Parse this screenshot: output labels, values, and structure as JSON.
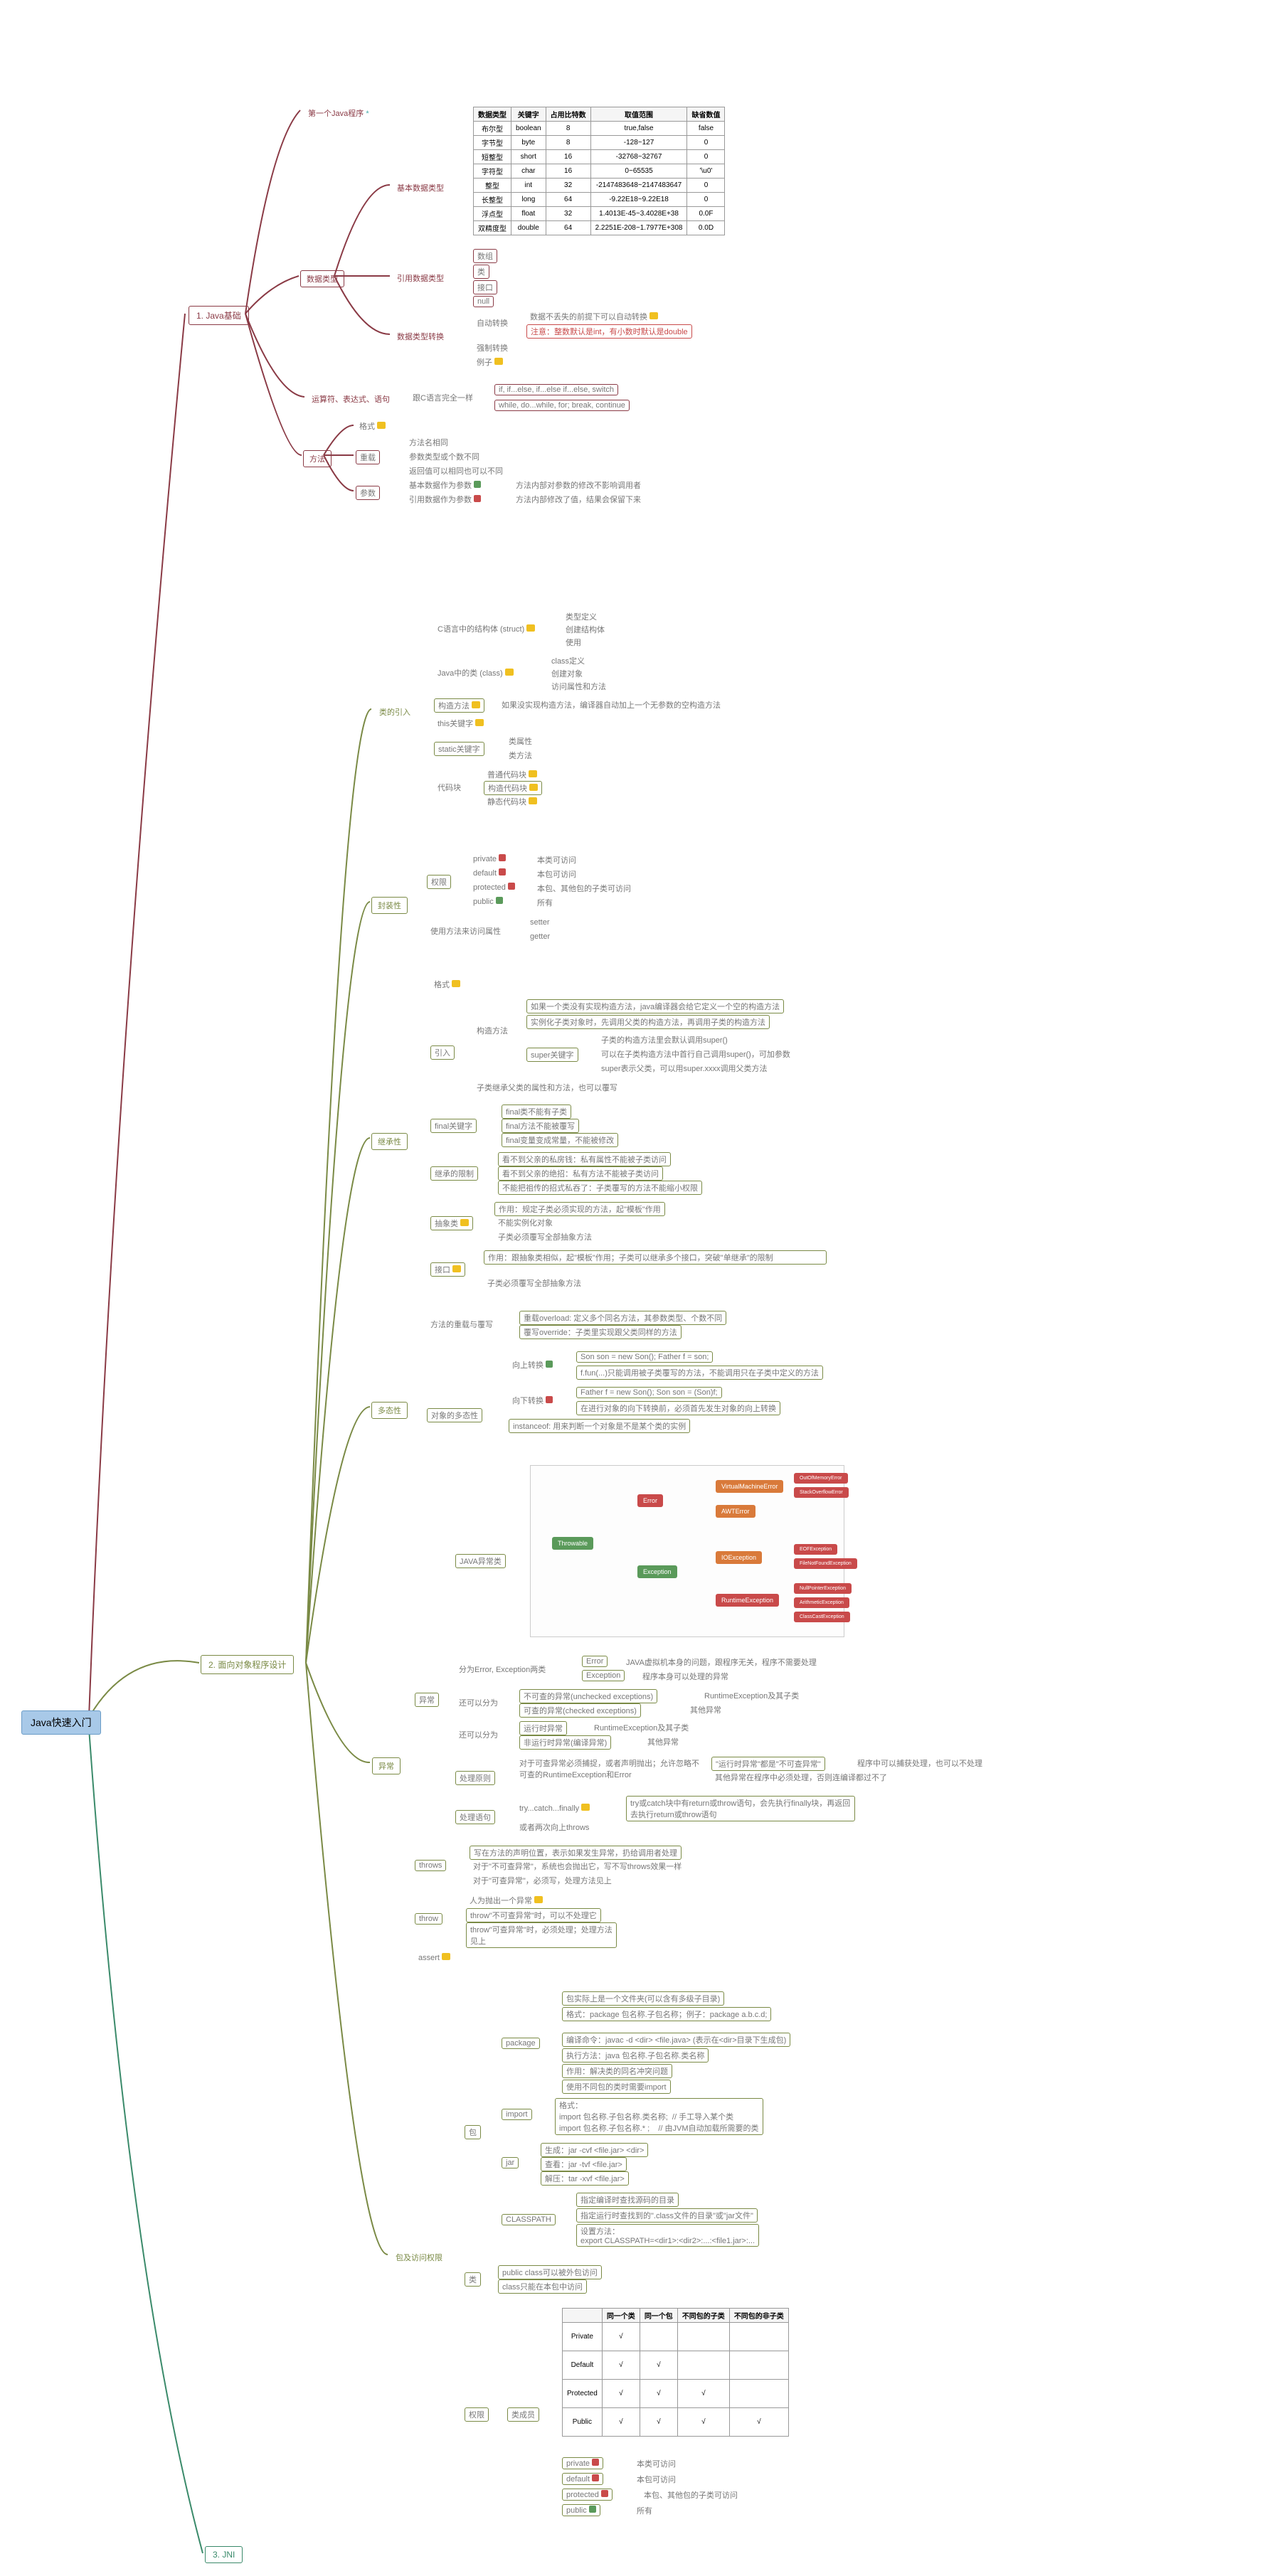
{
  "root": "Java快速入门",
  "s1": "1. Java基础",
  "s2": "2. 面向对象程序设计",
  "s3": "3. JNI",
  "firstprog": "第一个Java程序",
  "datatype": "数据类型",
  "basictype": "基本数据类型",
  "reftype": "引用数据类型",
  "typeconv": "数据类型转换",
  "ref_arr": "数组",
  "ref_class": "类",
  "ref_if": "接口",
  "ref_null": "null",
  "autoconv": "自动转换",
  "forceconv": "强制转换",
  "example": "例子",
  "autoconv_note": "数据不丢失的前提下可以自动转换",
  "autoconv_warn": "注意：整数默认是int，有小数时默认是double",
  "op": "运算符、表达式、语句",
  "op_c": "跟C语言完全一样",
  "op_if": "if, if...else, if...else if...else, switch",
  "op_loop": "while, do...while, for; break, continue",
  "method": "方法",
  "format": "格式",
  "overload": "重载",
  "param": "参数",
  "ol1": "方法名相同",
  "ol2": "参数类型或个数不同",
  "ol3": "返回值可以相同也可以不同",
  "p_basic": "基本数据作为参数",
  "p_basic_n": "方法内部对参数的修改不影响调用者",
  "p_ref": "引用数据作为参数",
  "p_ref_n": "方法内部修改了值，结果会保留下来",
  "tab_h1": "数据类型",
  "tab_h2": "关键字",
  "tab_h3": "占用比特数",
  "tab_h4": "取值范围",
  "tab_h5": "缺省数值",
  "tab": [
    [
      "布尔型",
      "boolean",
      "8",
      "true,false",
      "false"
    ],
    [
      "字节型",
      "byte",
      "8",
      "-128~127",
      "0"
    ],
    [
      "短整型",
      "short",
      "16",
      "-32768~32767",
      "0"
    ],
    [
      "字符型",
      "char",
      "16",
      "0~65535",
      "'\\u0'"
    ],
    [
      "整型",
      "int",
      "32",
      "-2147483648~2147483647",
      "0"
    ],
    [
      "长整型",
      "long",
      "64",
      "-9.22E18~9.22E18",
      "0"
    ],
    [
      "浮点型",
      "float",
      "32",
      "1.4013E-45~3.4028E+38",
      "0.0F"
    ],
    [
      "双精度型",
      "double",
      "64",
      "2.2251E-208~1.7977E+308",
      "0.0D"
    ]
  ],
  "classintro": "类的引入",
  "struct": "C语言中的结构体 (struct)",
  "struct1": "类型定义",
  "struct2": "创建结构体",
  "struct3": "使用",
  "javaclass": "Java中的类 (class)",
  "jc1": "class定义",
  "jc2": "创建对象",
  "jc3": "访问属性和方法",
  "ctor": "构造方法",
  "ctor_n": "如果没实现构造方法，编译器自动加上一个无参数的空构造方法",
  "thiskey": "this关键字",
  "statickey": "static关键字",
  "sk1": "类属性",
  "sk2": "类方法",
  "codeblk": "代码块",
  "cb1": "普通代码块",
  "cb2": "构造代码块",
  "cb3": "静态代码块",
  "encap": "封装性",
  "priv": "权限",
  "priv1": "private",
  "priv1n": "本类可访问",
  "priv2": "default",
  "priv2n": "本包可访问",
  "priv3": "protected",
  "priv3n": "本包、其他包的子类可访问",
  "priv4": "public",
  "priv4n": "所有",
  "usem": "使用方法来访问属性",
  "setter": "setter",
  "getter": "getter",
  "inherit": "继承性",
  "fmt": "格式",
  "intro": "引入",
  "ictor": "构造方法",
  "ic1": "如果一个类没有实现构造方法，java编译器会给它定义一个空的构造方法",
  "ic2": "实例化子类对象时，先调用父类的构造方法，再调用子类的构造方法",
  "superkey": "super关键字",
  "sk_a": "子类的构造方法里会默认调用super()",
  "sk_b": "可以在子类构造方法中首行自己调用super()，可加参数",
  "sk_c": "super表示父类，可以用super.xxxx调用父类方法",
  "childinherit": "子类继承父类的属性和方法，也可以覆写",
  "finalkey": "final关键字",
  "fk1": "final类不能有子类",
  "fk2": "final方法不能被覆写",
  "fk3": "final变量变成常量，不能被修改",
  "inheritlimit": "继承的限制",
  "il1": "看不到父亲的私房钱：私有属性不能被子类访问",
  "il2": "看不到父亲的绝招：私有方法不能被子类访问",
  "il3": "不能把祖传的招式私吞了：子类覆写的方法不能缩小权限",
  "abstract": "抽象类",
  "ab1": "作用：规定子类必须实现的方法，起\"模板\"作用",
  "ab2": "不能实例化对象",
  "ab3": "子类必须覆写全部抽象方法",
  "interface": "接口",
  "if1": "作用：跟抽象类相似，起\"模板\"作用；子类可以继承多个接口，突破\"单继承\"的限制",
  "if2": "子类必须覆写全部抽象方法",
  "poly": "多态性",
  "methodol": "方法的重载与覆写",
  "mol1": "重载overload: 定义多个同名方法，其参数类型、个数不同",
  "mol2": "覆写override：子类里实现跟父类同样的方法",
  "objpoly": "对象的多态性",
  "upcast": "向上转换",
  "upcast1": "Son son = new Son(); Father f = son;",
  "upcast2": "f.fun(...)只能调用被子类覆写的方法，不能调用只在子类中定义的方法",
  "downcast": "向下转换",
  "dc1": "Father f = new Son(); Son son = (Son)f;",
  "dc2": "在进行对象的向下转换前，必须首先发生对象的向上转换",
  "instanceof": "instanceof: 用来判断一个对象是不是某个类的实例",
  "exception": "异常",
  "exc": "异常",
  "javaexcclass": "JAVA异常类",
  "errexc": "分为Error, Exception两类",
  "err": "Error",
  "err_n": "JAVA虚拟机本身的问题，跟程序无关，程序不需要处理",
  "exc_n": "程序本身可以处理的异常",
  "exc_c": "Exception",
  "alsodiv": "还可以分为",
  "unchecked": "不可查的异常(unchecked exceptions)",
  "unchecked_n": "RuntimeException及其子类",
  "checked": "可查的异常(checked exceptions)",
  "checked_n": "其他异常",
  "alsodiv2": "还可以分为",
  "runtime": "运行时异常",
  "runtime_n": "RuntimeException及其子类",
  "nonruntime": "非运行时异常(编译异常)",
  "nonruntime_n": "其他异常",
  "handle": "处理原则",
  "hp1": "对于可查异常必须捕捉，或者声明抛出；允许忽略不可查的RuntimeException和Error",
  "hp2": "\"运行时异常\"都是\"不可查异常\"",
  "hp2n": "程序中可以捕获处理，也可以不处理",
  "hp3": "其他异常在程序中必须处理，否则连编译都过不了",
  "trycatch": "处理语句",
  "tc1": "try...catch...finally",
  "tc1n": "try或catch块中有return或throw语句，会先执行finally块，再返回去执行return或throw语句",
  "tc2": "或者两次向上throws",
  "throws": "throws",
  "th1": "写在方法的声明位置，表示如果发生异常，扔给调用者处理",
  "th2": "对于\"不可查异常\"，系统也会抛出它，写不写throws效果一样",
  "th3": "对于\"可查异常\"，必须写，处理方法见上",
  "throw": "throw",
  "trow1": "人为抛出一个异常",
  "trow2": "throw\"不可查异常\"时，可以不处理它",
  "trow3": "throw\"可查异常\"时，必须处理；处理方法见上",
  "assert": "assert",
  "pkg": "包及访问权限",
  "package": "package",
  "pkgsub": "包",
  "pk1": "包实际上是一个文件夹(可以含有多级子目录)",
  "pk2": "格式：package 包名称.子包名称；例子：package a.b.c.d;",
  "pk3": "编译命令：javac -d <dir> <file.java>  (表示在<dir>目录下生成包)",
  "pk4": "执行方法：java 包名称.子包名称.类名称",
  "pk5": "作用：解决类的同名冲突问题",
  "pk6": "使用不同包的类时需要import",
  "import": "import",
  "imp1": "格式：\nimport 包名称.子包名称.类名称;  // 手工导入某个类\nimport 包名称.子包名称.* ;    // 由JVM自动加载所需要的类",
  "jar": "jar",
  "jar1": "生成：jar -cvf <file.jar> <dir>",
  "jar2": "查看：jar -tvf <file.jar>",
  "jar3": "解压：tar -xvf <file.jar>",
  "classpath": "CLASSPATH",
  "cp1": "指定编译时查找源码的目录",
  "cp2": "指定运行时查找到的\".class文件的目录\"或\"jar文件\"",
  "cp3": "设置方法：\nexport CLASSPATH=<dir1>:<dir2>:...:<file1.jar>:...",
  "classacc": "类",
  "ca1": "public class可以被外包访问",
  "ca2": "class只能在本包中访问",
  "accpriv": "权限",
  "member": "类成员",
  "tab2_h1": "同一个类",
  "tab2_h2": "同一个包",
  "tab2_h3": "不同包的子类",
  "tab2_h4": "不同包的非子类",
  "tab2": [
    [
      "Private",
      "√",
      "",
      "",
      ""
    ],
    [
      "Default",
      "√",
      "√",
      "",
      ""
    ],
    [
      "Protected",
      "√",
      "√",
      "√",
      ""
    ],
    [
      "Public",
      "√",
      "√",
      "√",
      "√"
    ]
  ],
  "mp1": "private",
  "mp1n": "本类可访问",
  "mp2": "default",
  "mp2n": "本包可访问",
  "mp3": "protected",
  "mp3n": "本包、其他包的子类可访问",
  "mp4": "public",
  "mp4n": "所有"
}
